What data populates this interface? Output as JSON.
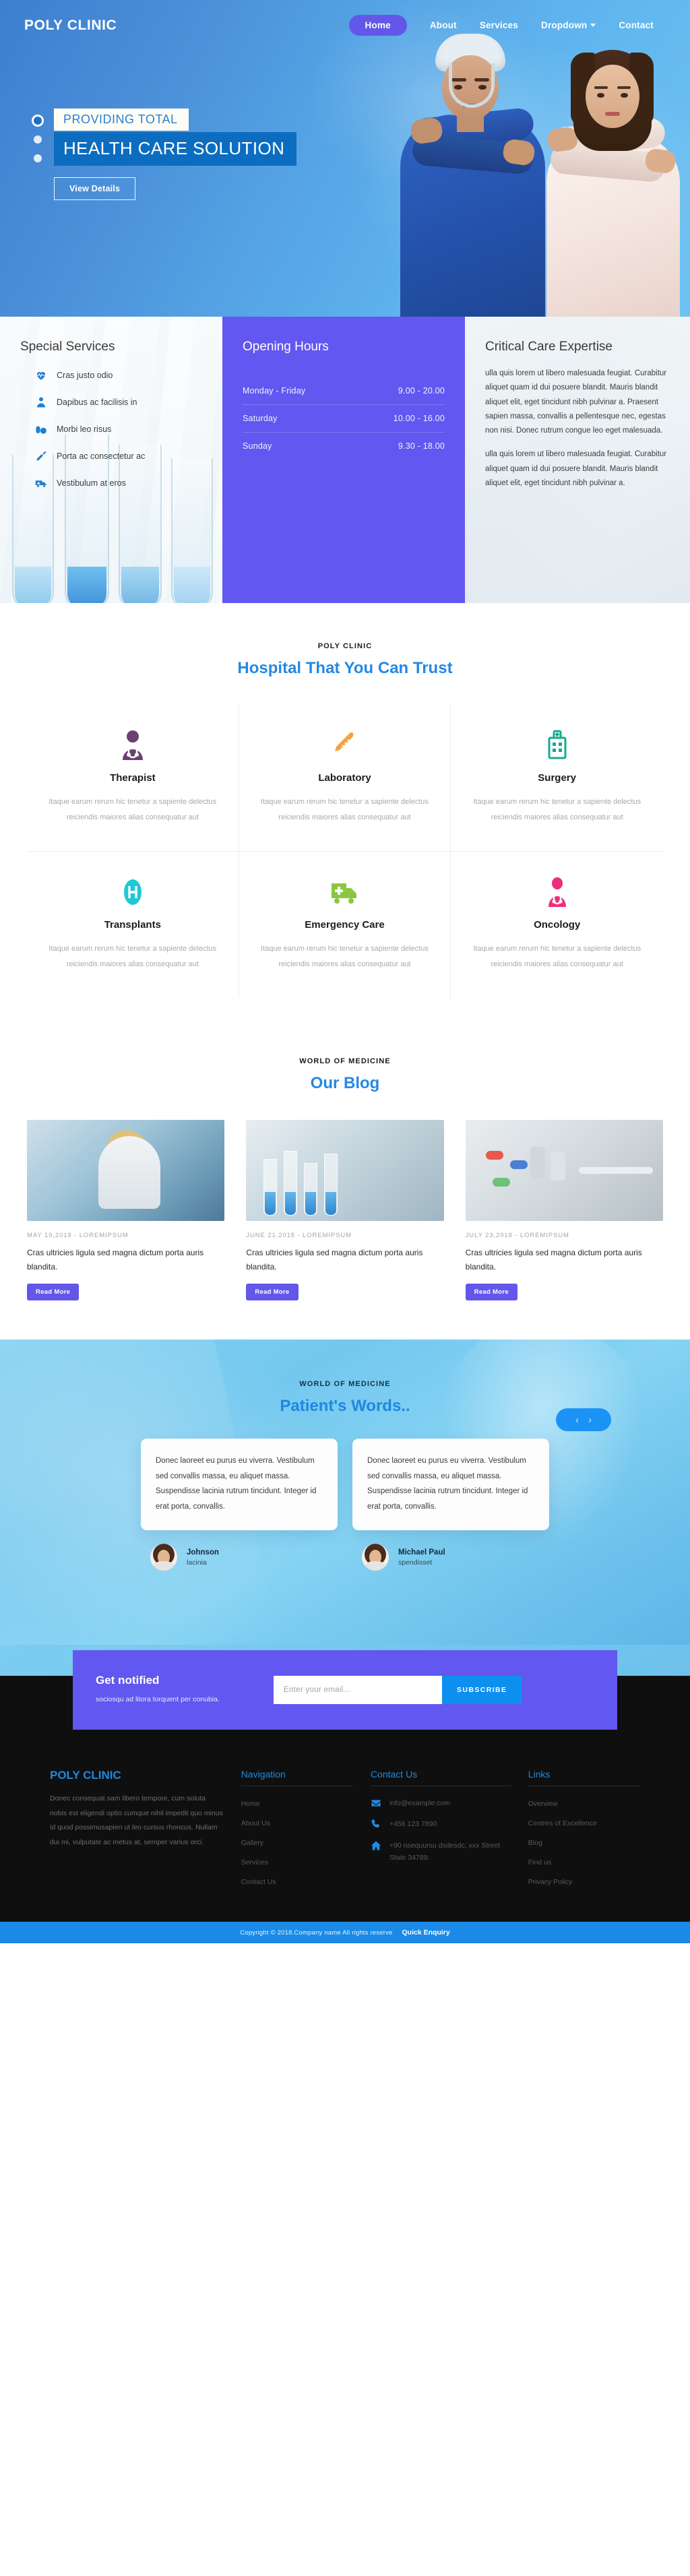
{
  "nav": {
    "brand": "POLY CLINIC",
    "items": [
      {
        "label": "Home",
        "active": true
      },
      {
        "label": "About",
        "active": false
      },
      {
        "label": "Services",
        "active": false
      },
      {
        "label": "Dropdown",
        "active": false,
        "caret": true
      },
      {
        "label": "Contact",
        "active": false
      }
    ]
  },
  "hero": {
    "eyebrow": "PROVIDING TOTAL",
    "headline": "HEALTH CARE SOLUTION",
    "button": "View Details",
    "slides": 3,
    "active_slide": 1
  },
  "special_services": {
    "title": "Special Services",
    "items": [
      {
        "icon": "heartbeat-icon",
        "label": "Cras justo odio"
      },
      {
        "icon": "doctor-icon",
        "label": "Dapibus ac facilisis in"
      },
      {
        "icon": "pills-icon",
        "label": "Morbi leo risus"
      },
      {
        "icon": "syringe-icon",
        "label": "Porta ac consectetur ac"
      },
      {
        "icon": "ambulance-icon",
        "label": "Vestibulum at eros"
      }
    ]
  },
  "opening_hours": {
    "title": "Opening Hours",
    "rows": [
      {
        "day": "Monday - Friday",
        "time": "9.00 - 20.00"
      },
      {
        "day": "Saturday",
        "time": "10.00 - 16.00"
      },
      {
        "day": "Sunday",
        "time": "9.30 - 18.00"
      }
    ]
  },
  "critical_care": {
    "title": "Critical Care Expertise",
    "paragraph1": "ulla quis lorem ut libero malesuada feugiat. Curabitur aliquet quam id dui posuere blandit. Mauris blandit aliquet elit, eget tincidunt nibh pulvinar a. Praesent sapien massa, convallis a pellentesque nec, egestas non nisi. Donec rutrum congue leo eget malesuada.",
    "paragraph2": "ulla quis lorem ut libero malesuada feugiat. Curabitur aliquet quam id dui posuere blandit. Mauris blandit aliquet elit, eget tincidunt nibh pulvinar a."
  },
  "trust": {
    "eyebrow": "POLY CLINIC",
    "title": "Hospital That You Can Trust",
    "body": "Itaque earum rerum hic tenetur a sapiente delectus reiciendis maiores alias consequatur aut",
    "cards": [
      {
        "icon": "therapist-icon",
        "color": "#6d3f74",
        "title": "Therapist"
      },
      {
        "icon": "thermometer-icon",
        "color": "#f5a341",
        "title": "Laboratory"
      },
      {
        "icon": "hospital-icon",
        "color": "#13ab90",
        "title": "Surgery"
      },
      {
        "icon": "hospital-h-icon",
        "color": "#1ecad3",
        "title": "Transplants"
      },
      {
        "icon": "ambulance-icon",
        "color": "#8cc63f",
        "title": "Emergency Care"
      },
      {
        "icon": "oncology-icon",
        "color": "#ec2f7b",
        "title": "Oncology"
      }
    ]
  },
  "blog": {
    "eyebrow": "WORLD OF MEDICINE",
    "title": "Our Blog",
    "posts": [
      {
        "meta": "MAY  19,2018  -  LOREMIPSUM",
        "title": "Cras ultricies ligula sed magna dictum porta auris blandita.",
        "button": "Read More"
      },
      {
        "meta": "JUNE  21,2018  -  LOREMIPSUM",
        "title": "Cras ultricies ligula sed magna dictum porta auris blandita.",
        "button": "Read More"
      },
      {
        "meta": "JULY  23,2018  -  LOREMIPSUM",
        "title": "Cras ultricies ligula sed magna dictum porta auris blandita.",
        "button": "Read More"
      }
    ]
  },
  "testimonials": {
    "eyebrow": "WORLD OF MEDICINE",
    "title": "Patient's Words..",
    "prev": "‹",
    "next": "›",
    "items": [
      {
        "quote": "Donec laoreet eu purus eu viverra. Vestibulum sed convallis massa, eu aliquet massa. Suspendisse lacinia rutrum tincidunt. Integer id erat porta, convallis.",
        "name": "Johnson",
        "role": "lacinia"
      },
      {
        "quote": "Donec laoreet eu purus eu viverra. Vestibulum sed convallis massa, eu aliquet massa. Suspendisse lacinia rutrum tincidunt. Integer id erat porta, convallis.",
        "name": "Michael Paul",
        "role": "spendisset"
      }
    ]
  },
  "newsletter": {
    "title": "Get notified",
    "subtitle": "sociosqu ad litora torquent per conubia.",
    "placeholder": "Enter your email...",
    "value": "",
    "button": "SUBSCRIBE"
  },
  "footer": {
    "brand": "POLY CLINIC",
    "about": "Donec consequat sam libero tempore, cum soluta nobis est eligendi optio cumque nihil impedit quo minus id quod possimusapien ut leo cursus rhoncus. Nullam dui mi, vulputate ac metus at, semper varius orci.",
    "navigation": {
      "title": "Navigation",
      "items": [
        "Home",
        "About Us",
        "Gallery",
        "Services",
        "Contact Us"
      ]
    },
    "contact": {
      "title": "Contact Us",
      "email": "info@example.com",
      "phone": "+456 123 7890",
      "address": "+90 nsequursu dsdesdc, xxx Street State 34789."
    },
    "links": {
      "title": "Links",
      "items": [
        "Overview",
        "Centres of Excellence",
        "Blog",
        "Find us",
        "Privacy Policy"
      ]
    }
  },
  "copyright": {
    "text": "Copyright © 2018.Company name All rights reserve",
    "quick_enquiry": "Quick Enquiry"
  },
  "colors": {
    "primary_blue": "#1a8ae6",
    "purple": "#6257f0",
    "hero_blue": "#0c6dc0",
    "dark": "#0f0f0f"
  }
}
